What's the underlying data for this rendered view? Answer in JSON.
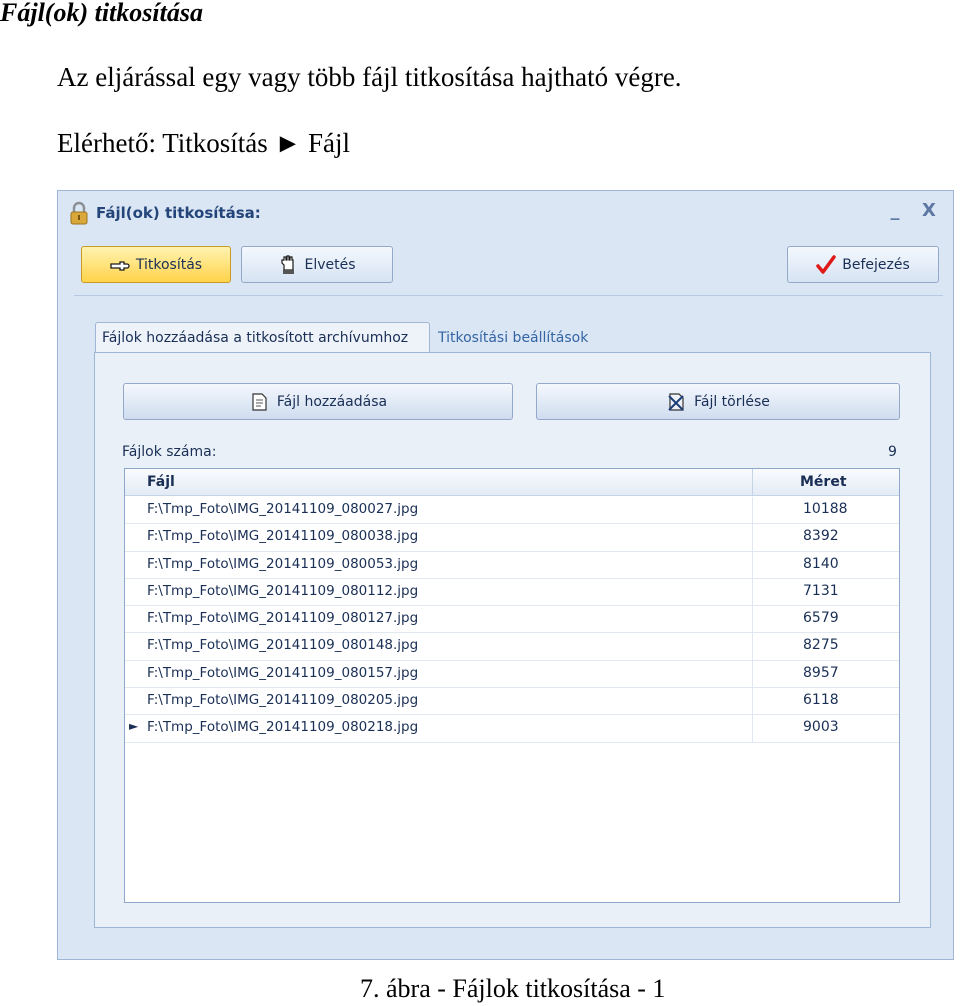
{
  "document": {
    "heading": "Fájl(ok) titkosítása",
    "intro": "Az eljárással egy vagy több fájl titkosítása hajtható végre.",
    "path": "Elérhető: Titkosítás ► Fájl",
    "caption": "7. ábra - Fájlok titkosítása - 1"
  },
  "window": {
    "title": "Fájl(ok) titkosítása:",
    "minimize": "_",
    "close": "X"
  },
  "toolbar": {
    "encrypt_label": "Titkosítás",
    "discard_label": "Elvetés",
    "finish_label": "Befejezés"
  },
  "tabs": [
    {
      "label": "Fájlok hozzáadása a titkosított archívumhoz",
      "active": true
    },
    {
      "label": "Titkosítási beállítások",
      "active": false
    }
  ],
  "panel": {
    "add_file_label": "Fájl hozzáadása",
    "delete_file_label": "Fájl törlése",
    "file_count_label": "Fájlok száma:",
    "file_count_value": "9"
  },
  "grid": {
    "columns": {
      "file": "Fájl",
      "size": "Méret"
    },
    "rows": [
      {
        "file": "F:\\Tmp_Foto\\IMG_20141109_080027.jpg",
        "size": "10188",
        "current": false
      },
      {
        "file": "F:\\Tmp_Foto\\IMG_20141109_080038.jpg",
        "size": "8392",
        "current": false
      },
      {
        "file": "F:\\Tmp_Foto\\IMG_20141109_080053.jpg",
        "size": "8140",
        "current": false
      },
      {
        "file": "F:\\Tmp_Foto\\IMG_20141109_080112.jpg",
        "size": "7131",
        "current": false
      },
      {
        "file": "F:\\Tmp_Foto\\IMG_20141109_080127.jpg",
        "size": "6579",
        "current": false
      },
      {
        "file": "F:\\Tmp_Foto\\IMG_20141109_080148.jpg",
        "size": "8275",
        "current": false
      },
      {
        "file": "F:\\Tmp_Foto\\IMG_20141109_080157.jpg",
        "size": "8957",
        "current": false
      },
      {
        "file": "F:\\Tmp_Foto\\IMG_20141109_080205.jpg",
        "size": "6118",
        "current": false
      },
      {
        "file": "F:\\Tmp_Foto\\IMG_20141109_080218.jpg",
        "size": "9003",
        "current": true
      }
    ],
    "current_marker": "►"
  },
  "colors": {
    "accent": "#ffd34a",
    "check": "#e01818",
    "title_text": "#24457a"
  },
  "icons": {
    "title": "lock-icon",
    "encrypt": "pointing-hand-icon",
    "discard": "hand-stop-icon",
    "finish": "checkmark-icon",
    "add_file": "document-add-icon",
    "delete_file": "document-delete-icon"
  }
}
